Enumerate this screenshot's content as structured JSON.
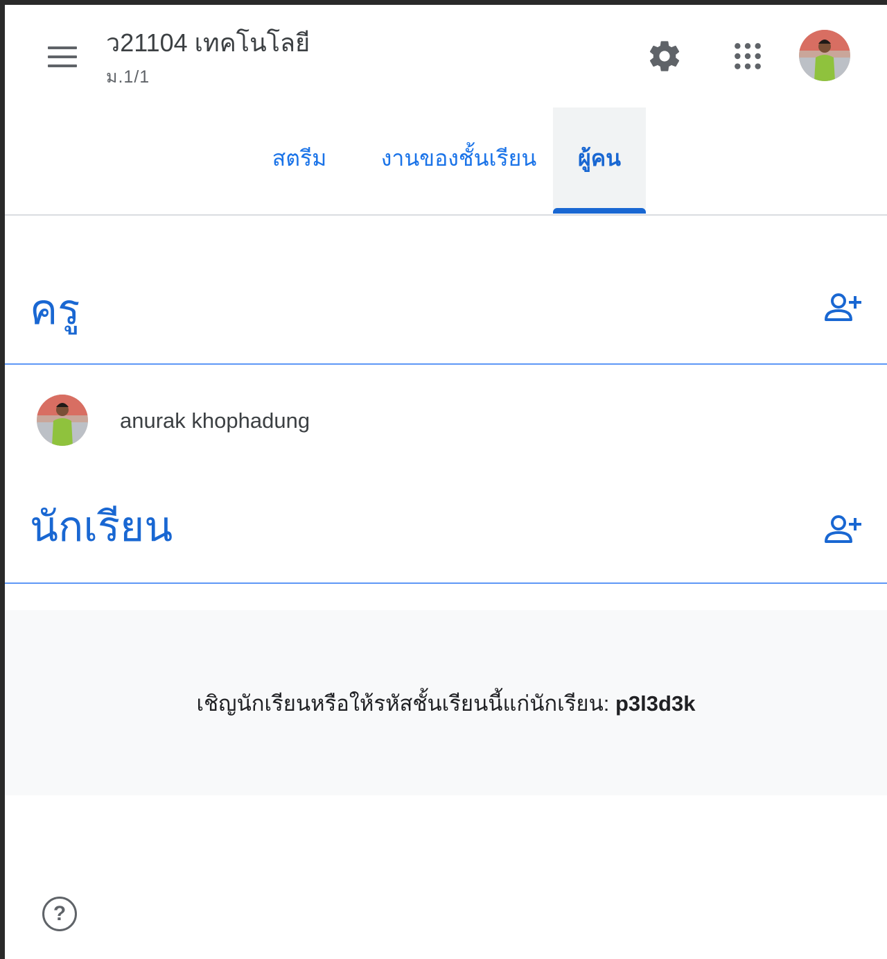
{
  "header": {
    "class_title": "ว21104 เทคโนโลยี",
    "class_section": "ม.1/1",
    "icons": [
      "menu-icon",
      "gear-icon",
      "apps-grid-icon",
      "account-avatar"
    ]
  },
  "tabs": [
    {
      "label": "สตรีม",
      "active": false
    },
    {
      "label": "งานของชั้นเรียน",
      "active": false
    },
    {
      "label": "ผู้คน",
      "active": true
    }
  ],
  "teachers": {
    "title": "ครู",
    "list": [
      {
        "name": "anurak khophadung"
      }
    ]
  },
  "students": {
    "title": "นักเรียน"
  },
  "invite": {
    "text": "เชิญนักเรียนหรือให้รหัสชั้นเรียนนี้แก่นักเรียน: ",
    "code": "p3l3d3k"
  },
  "colors": {
    "accent": "#1967d2",
    "divider": "#4285f4",
    "invite_background": "#f8f9fa",
    "tab_active_bg": "#f1f3f4"
  }
}
